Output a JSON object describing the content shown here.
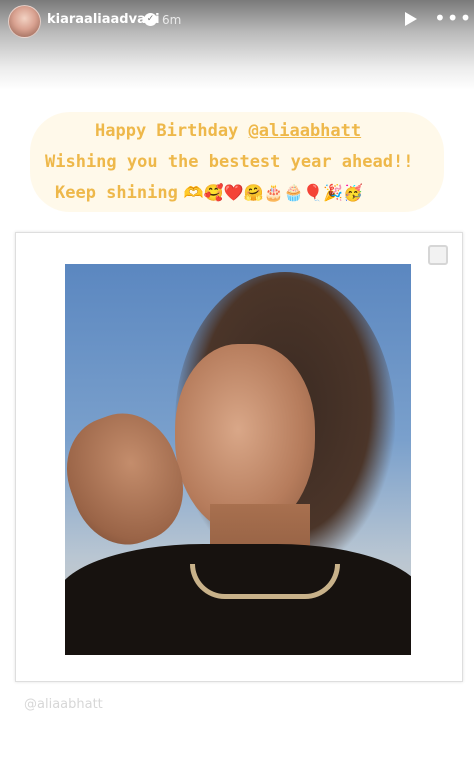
{
  "story": {
    "username": "kiaraaliaadvani",
    "time_ago": "6m",
    "verified_glyph": "✓",
    "more_glyph": "•••"
  },
  "greeting": {
    "line1_prefix": "Happy Birthday ",
    "line1_mention": "@aliaabhatt",
    "line2": "Wishing you the bestest year ahead!!",
    "line3": "Keep shining",
    "line3_emojis": "🫶🥰❤️🤗🎂🧁🎈🎉🥳"
  },
  "photo_tag": "@aliaabhatt",
  "colors": {
    "text_accent": "#eeb84a",
    "background": "#ffffff"
  },
  "icons": {
    "play": "play-icon",
    "more": "more-options-icon",
    "verified": "verified-badge-icon"
  }
}
